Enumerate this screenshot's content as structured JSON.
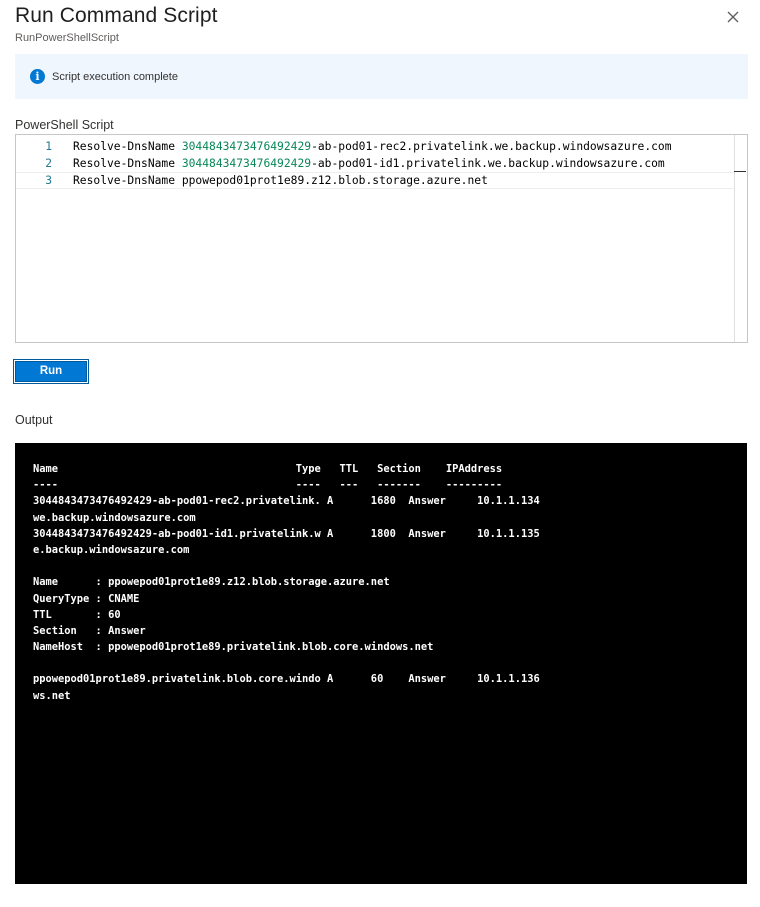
{
  "header": {
    "title": "Run Command Script",
    "subtitle": "RunPowerShellScript"
  },
  "banner": {
    "icon": "info-icon",
    "message": "Script execution complete"
  },
  "script": {
    "label": "PowerShell Script",
    "lines": [
      {
        "number": "1",
        "cmd": "Resolve-DnsName ",
        "num": "3044843473476492429",
        "rest": "-ab-pod01-rec2.privatelink.we.backup.windowsazure.com"
      },
      {
        "number": "2",
        "cmd": "Resolve-DnsName ",
        "num": "3044843473476492429",
        "rest": "-ab-pod01-id1.privatelink.we.backup.windowsazure.com"
      },
      {
        "number": "3",
        "cmd": "Resolve-DnsName ",
        "num": "",
        "rest": "ppowepod01prot1e89.z12.blob.storage.azure.net"
      }
    ]
  },
  "run_button": {
    "label": "Run"
  },
  "output": {
    "label": "Output",
    "lines": [
      "Name                                      Type   TTL   Section    IPAddress",
      "----                                      ----   ---   -------    ---------",
      "3044843473476492429-ab-pod01-rec2.privatelink. A      1680  Answer     10.1.1.134",
      "we.backup.windowsazure.com",
      "3044843473476492429-ab-pod01-id1.privatelink.w A      1800  Answer     10.1.1.135",
      "e.backup.windowsazure.com",
      "",
      "Name      : ppowepod01prot1e89.z12.blob.storage.azure.net",
      "QueryType : CNAME",
      "TTL       : 60",
      "Section   : Answer",
      "NameHost  : ppowepod01prot1e89.privatelink.blob.core.windows.net",
      "",
      "ppowepod01prot1e89.privatelink.blob.core.windo A      60    Answer     10.1.1.136",
      "ws.net"
    ]
  }
}
